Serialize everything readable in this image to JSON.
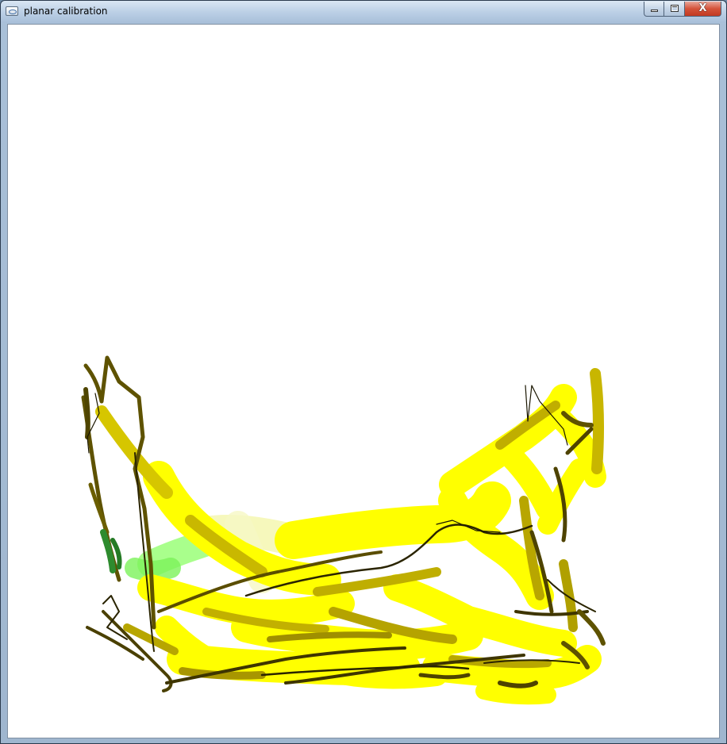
{
  "window": {
    "title": "planar calibration",
    "icons": {
      "app": "app-window-icon",
      "minimize": "minimize-icon",
      "maximize": "maximize-icon",
      "close": "close-icon"
    },
    "close_glyph": "X"
  },
  "canvas": {
    "background": "#ffffff",
    "colors": {
      "bright_yellow": "#ffff00",
      "mid_yellow": "#e6d800",
      "olive": "#c8b400",
      "dark_olive": "#5e5200",
      "near_black": "#2a2400",
      "light_green": "#8cff66",
      "pale_yellow": "#f4f7b0",
      "dark_green": "#2e8b2e"
    }
  }
}
